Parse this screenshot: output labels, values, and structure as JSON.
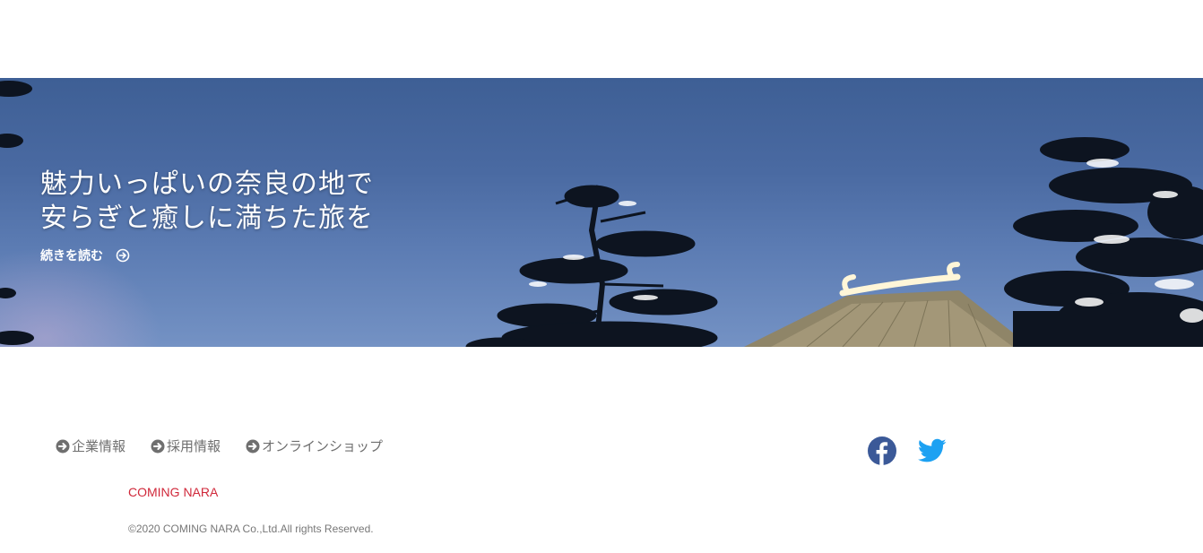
{
  "hero": {
    "title_line1": "魅力いっぱいの奈良の地で",
    "title_line2": "安らぎと癒しに満ちた旅を",
    "read_more_label": "続きを読む",
    "read_more_icon": "circle-arrow-right-icon"
  },
  "footer": {
    "nav": [
      {
        "label": "企業情報",
        "icon": "circle-arrow-right-icon"
      },
      {
        "label": "採用情報",
        "icon": "circle-arrow-right-icon"
      },
      {
        "label": "オンラインショップ",
        "icon": "circle-arrow-right-icon"
      }
    ],
    "social": [
      {
        "name": "facebook-icon",
        "color": "#3b5998"
      },
      {
        "name": "twitter-icon",
        "color": "#1da1f2"
      }
    ],
    "brand": "COMING NARA",
    "copyright": "©2020 COMING NARA Co.,Ltd.All rights Reserved."
  },
  "colors": {
    "sky": "#4a6aa2",
    "brand_red": "#d0283a",
    "nav_gray": "#6f6f6f",
    "facebook": "#3b5998",
    "twitter": "#1da1f2"
  }
}
